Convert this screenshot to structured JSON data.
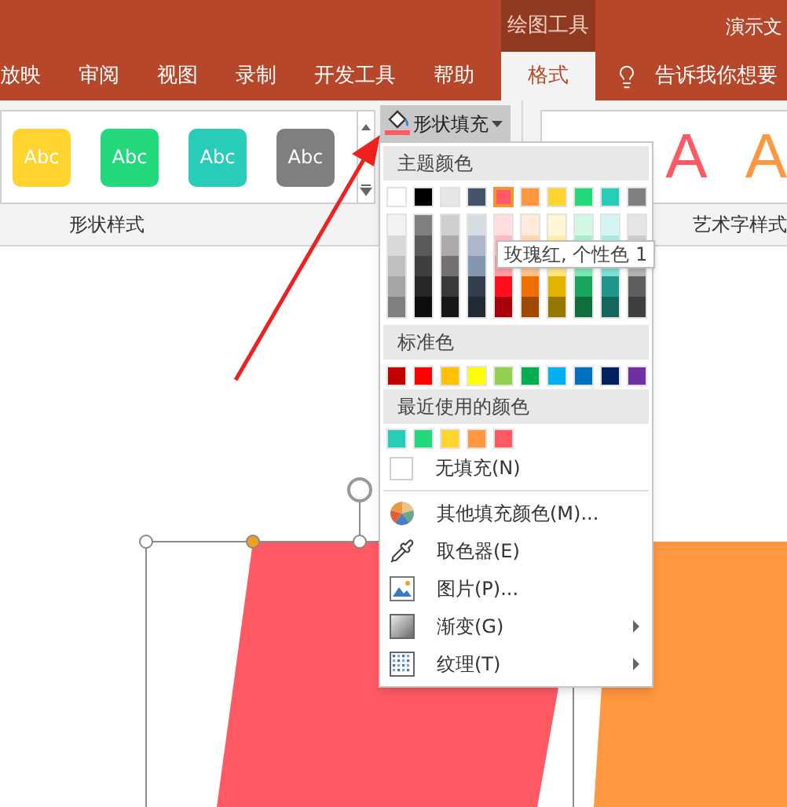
{
  "title_bar": {
    "contextual_tab": "绘图工具",
    "title": "演示文"
  },
  "tabs": [
    {
      "label": "放映",
      "selected": false
    },
    {
      "label": "审阅",
      "selected": false
    },
    {
      "label": "视图",
      "selected": false
    },
    {
      "label": "录制",
      "selected": false
    },
    {
      "label": "开发工具",
      "selected": false
    },
    {
      "label": "帮助",
      "selected": false
    },
    {
      "label": "格式",
      "selected": true
    }
  ],
  "tell_me": "告诉我你想要",
  "ribbon": {
    "shape_styles": {
      "label": "形状样式",
      "tiles": [
        {
          "label": "Abc",
          "color": "#ffd42f"
        },
        {
          "label": "Abc",
          "color": "#24d87e"
        },
        {
          "label": "Abc",
          "color": "#29cbb9"
        },
        {
          "label": "Abc",
          "color": "#7f7f7f"
        }
      ]
    },
    "fill_button": {
      "label": "形状填充",
      "color": "#ff5a64"
    },
    "wordart_styles": {
      "label": "艺术字样式",
      "letters": [
        {
          "label": "A",
          "color": "#ff5a64"
        },
        {
          "label": "A",
          "color": "#ff9640"
        }
      ]
    }
  },
  "fill_menu": {
    "theme_header": "主题颜色",
    "theme_colors": [
      {
        "color": "#ffffff",
        "selected": false
      },
      {
        "color": "#000000",
        "selected": false
      },
      {
        "color": "#e7e6e6",
        "selected": false
      },
      {
        "color": "#44546a",
        "selected": false
      },
      {
        "color": "#ff5a64",
        "selected": true
      },
      {
        "color": "#ff9640",
        "selected": false
      },
      {
        "color": "#ffd42f",
        "selected": false
      },
      {
        "color": "#24d87e",
        "selected": false
      },
      {
        "color": "#29cbb9",
        "selected": false
      },
      {
        "color": "#7f7f7f",
        "selected": false
      }
    ],
    "shade_columns": [
      {
        "shades": [
          {
            "color": "#f2f2f2"
          },
          {
            "color": "#d9d9d9"
          },
          {
            "color": "#bfbfbf"
          },
          {
            "color": "#a6a6a6"
          },
          {
            "color": "#7f7f7f"
          }
        ]
      },
      {
        "shades": [
          {
            "color": "#7f7f7f"
          },
          {
            "color": "#595959"
          },
          {
            "color": "#3f3f3f"
          },
          {
            "color": "#262626"
          },
          {
            "color": "#0d0d0d"
          }
        ]
      },
      {
        "shades": [
          {
            "color": "#d0cece"
          },
          {
            "color": "#aeaaaa"
          },
          {
            "color": "#757070"
          },
          {
            "color": "#3a3838"
          },
          {
            "color": "#171616"
          }
        ]
      },
      {
        "shades": [
          {
            "color": "#d6dce4"
          },
          {
            "color": "#adb9ca"
          },
          {
            "color": "#8497b0"
          },
          {
            "color": "#323f4f"
          },
          {
            "color": "#222a35"
          }
        ]
      },
      {
        "shades": [
          {
            "color": "#ffdee0"
          },
          {
            "color": "#ffbdc1"
          },
          {
            "color": "#ff9ca2"
          },
          {
            "color": "#ff0e1c"
          },
          {
            "color": "#a8000a"
          }
        ]
      },
      {
        "shades": [
          {
            "color": "#ffeadb"
          },
          {
            "color": "#ffd5b3"
          },
          {
            "color": "#ffc08c"
          },
          {
            "color": "#ee6e00"
          },
          {
            "color": "#9f4900"
          }
        ]
      },
      {
        "shades": [
          {
            "color": "#fff6d5"
          },
          {
            "color": "#ffeeac"
          },
          {
            "color": "#ffe582"
          },
          {
            "color": "#e2b400"
          },
          {
            "color": "#967800"
          }
        ]
      },
      {
        "shades": [
          {
            "color": "#d3f7e5"
          },
          {
            "color": "#a7efcb"
          },
          {
            "color": "#7ce8b1"
          },
          {
            "color": "#1ba45e"
          },
          {
            "color": "#126d3f"
          }
        ]
      },
      {
        "shades": [
          {
            "color": "#d4f5f1"
          },
          {
            "color": "#a9ebe3"
          },
          {
            "color": "#7ee0d5"
          },
          {
            "color": "#1f988a"
          },
          {
            "color": "#14655c"
          }
        ]
      },
      {
        "shades": [
          {
            "color": "#e5e5e5"
          },
          {
            "color": "#cccccc"
          },
          {
            "color": "#b2b2b2"
          },
          {
            "color": "#5f5f5f"
          },
          {
            "color": "#3f3f3f"
          }
        ]
      }
    ],
    "standard_header": "标准色",
    "standard_colors": [
      {
        "color": "#c00000"
      },
      {
        "color": "#ff0000"
      },
      {
        "color": "#ffc000"
      },
      {
        "color": "#ffff00"
      },
      {
        "color": "#92d050"
      },
      {
        "color": "#00b050"
      },
      {
        "color": "#00b0f0"
      },
      {
        "color": "#0070c0"
      },
      {
        "color": "#002060"
      },
      {
        "color": "#7030a0"
      }
    ],
    "recent_header": "最近使用的颜色",
    "recent_colors": [
      {
        "color": "#29cbb9"
      },
      {
        "color": "#24d87e"
      },
      {
        "color": "#ffd42f"
      },
      {
        "color": "#ff9640"
      },
      {
        "color": "#ff5a64"
      }
    ],
    "no_fill": "无填充(N)",
    "items": [
      {
        "label": "其他填充颜色(M)...",
        "submenu": false
      },
      {
        "label": "取色器(E)",
        "submenu": false
      },
      {
        "label": "图片(P)...",
        "submenu": false
      },
      {
        "label": "渐变(G)",
        "submenu": true
      },
      {
        "label": "纹理(T)",
        "submenu": true
      }
    ]
  },
  "tooltip": "玫瑰红, 个性色 1"
}
